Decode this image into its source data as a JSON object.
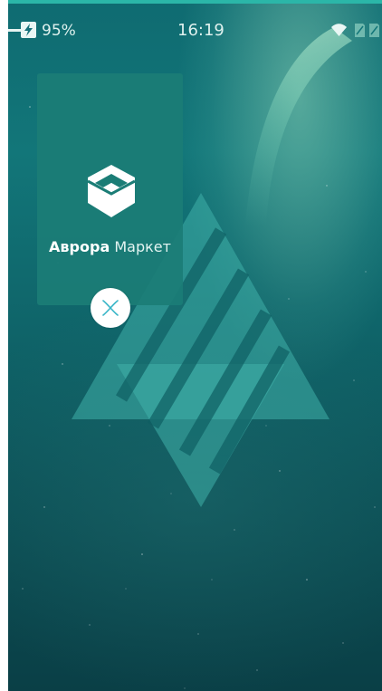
{
  "status_bar": {
    "battery_percent": "95%",
    "time": "16:19",
    "icons": [
      "charging-icon",
      "wifi-icon",
      "sim-card-icon",
      "sim-card-icon"
    ]
  },
  "app_cover": {
    "title_bold": "Аврора",
    "title_light": "Маркет",
    "icon": "aurora-market-icon",
    "close_icon": "close-icon"
  },
  "colors": {
    "accent": "#2bb6a8",
    "cover_background": "#1b7d76",
    "wallpaper_top": "#0f6b71",
    "wallpaper_bottom": "#0a3f46",
    "close_button": "#ffffff",
    "close_icon": "#37b5c7"
  }
}
